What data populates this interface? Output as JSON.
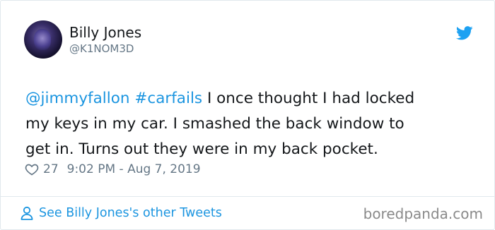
{
  "tweet": {
    "author_name": "Billy Jones",
    "author_handle": "@K1NOM3D",
    "mention": "@jimmyfallon",
    "hashtag": "#carfails",
    "text_line1": " I once thought I had locked",
    "text_line2": "my keys in my car. I smashed the back window to",
    "text_line3": "get in. Turns out they were in my back pocket.",
    "likes": "27",
    "timestamp": "9:02 PM - Aug 7, 2019",
    "footer_link": "See Billy Jones's other Tweets"
  },
  "watermark": "boredpanda.com",
  "icons": {
    "bird": "twitter-bird-icon",
    "heart": "heart-icon",
    "person": "person-icon"
  },
  "colors": {
    "link": "#1b95e0",
    "text": "#14171a",
    "muted": "#657786",
    "twitter_blue": "#1da1f2"
  }
}
